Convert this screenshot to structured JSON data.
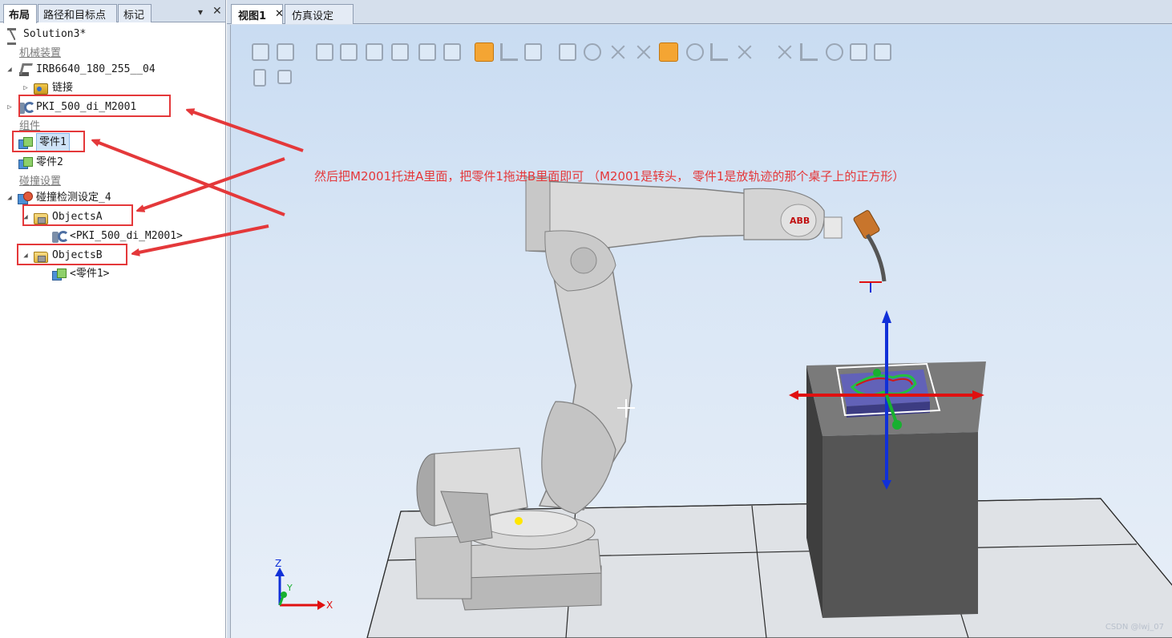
{
  "left_panel": {
    "tabs": [
      "布局",
      "路径和目标点",
      "标记"
    ],
    "dropdown_glyph": "▾",
    "close_glyph": "✕"
  },
  "tree": {
    "solution": "Solution3*",
    "group_mechanisms": "机械装置",
    "robot": "IRB6640_180_255__04",
    "links": "链接",
    "tool": "PKI_500_di_M2001",
    "group_components": "组件",
    "part1": "零件1",
    "part2": "零件2",
    "group_collision": "碰撞设置",
    "collision_set": "碰撞检测设定_4",
    "objects_a": "ObjectsA",
    "objects_a_child": "<PKI_500_di_M2001>",
    "objects_b": "ObjectsB",
    "objects_b_child": "<零件1>"
  },
  "view_tabs": {
    "view1": "视图1",
    "view1_close": "✕",
    "sim": "仿真设定"
  },
  "viewport": {
    "annotation": "然后把M2001托进A里面，把零件1拖进B里面即可   （M2001是转头， 零件1是放轨迹的那个桌子上的正方形）",
    "robot_brand": "ABB",
    "axis_z": "Z",
    "axis_y": "Y",
    "axis_x": "X",
    "watermark": "CSDN @lwj_07"
  },
  "colors": {
    "annotation_red": "#e4383a",
    "highlight_orange": "#f4a533",
    "axis_blue": "#1030d8",
    "axis_red": "#e01010",
    "axis_green": "#18b030"
  }
}
